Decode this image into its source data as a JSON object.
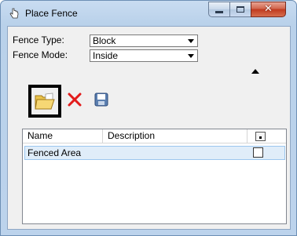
{
  "window": {
    "title": "Place Fence"
  },
  "form": {
    "fence_type_label": "Fence Type:",
    "fence_type_value": "Block",
    "fence_mode_label": "Fence Mode:",
    "fence_mode_value": "Inside"
  },
  "toolbar": {
    "icons": [
      "open-folder-icon",
      "delete-x-icon",
      "save-disk-icon"
    ]
  },
  "list": {
    "columns": [
      "Name",
      "Description"
    ],
    "rows": [
      {
        "name": "Fenced Area",
        "description": "",
        "checked": false
      }
    ]
  },
  "colors": {
    "title_gradient": "#bcd3ec",
    "close_button": "#c03a1f",
    "delete_icon": "#e21b1b",
    "selected_row": "#e0edf9"
  }
}
